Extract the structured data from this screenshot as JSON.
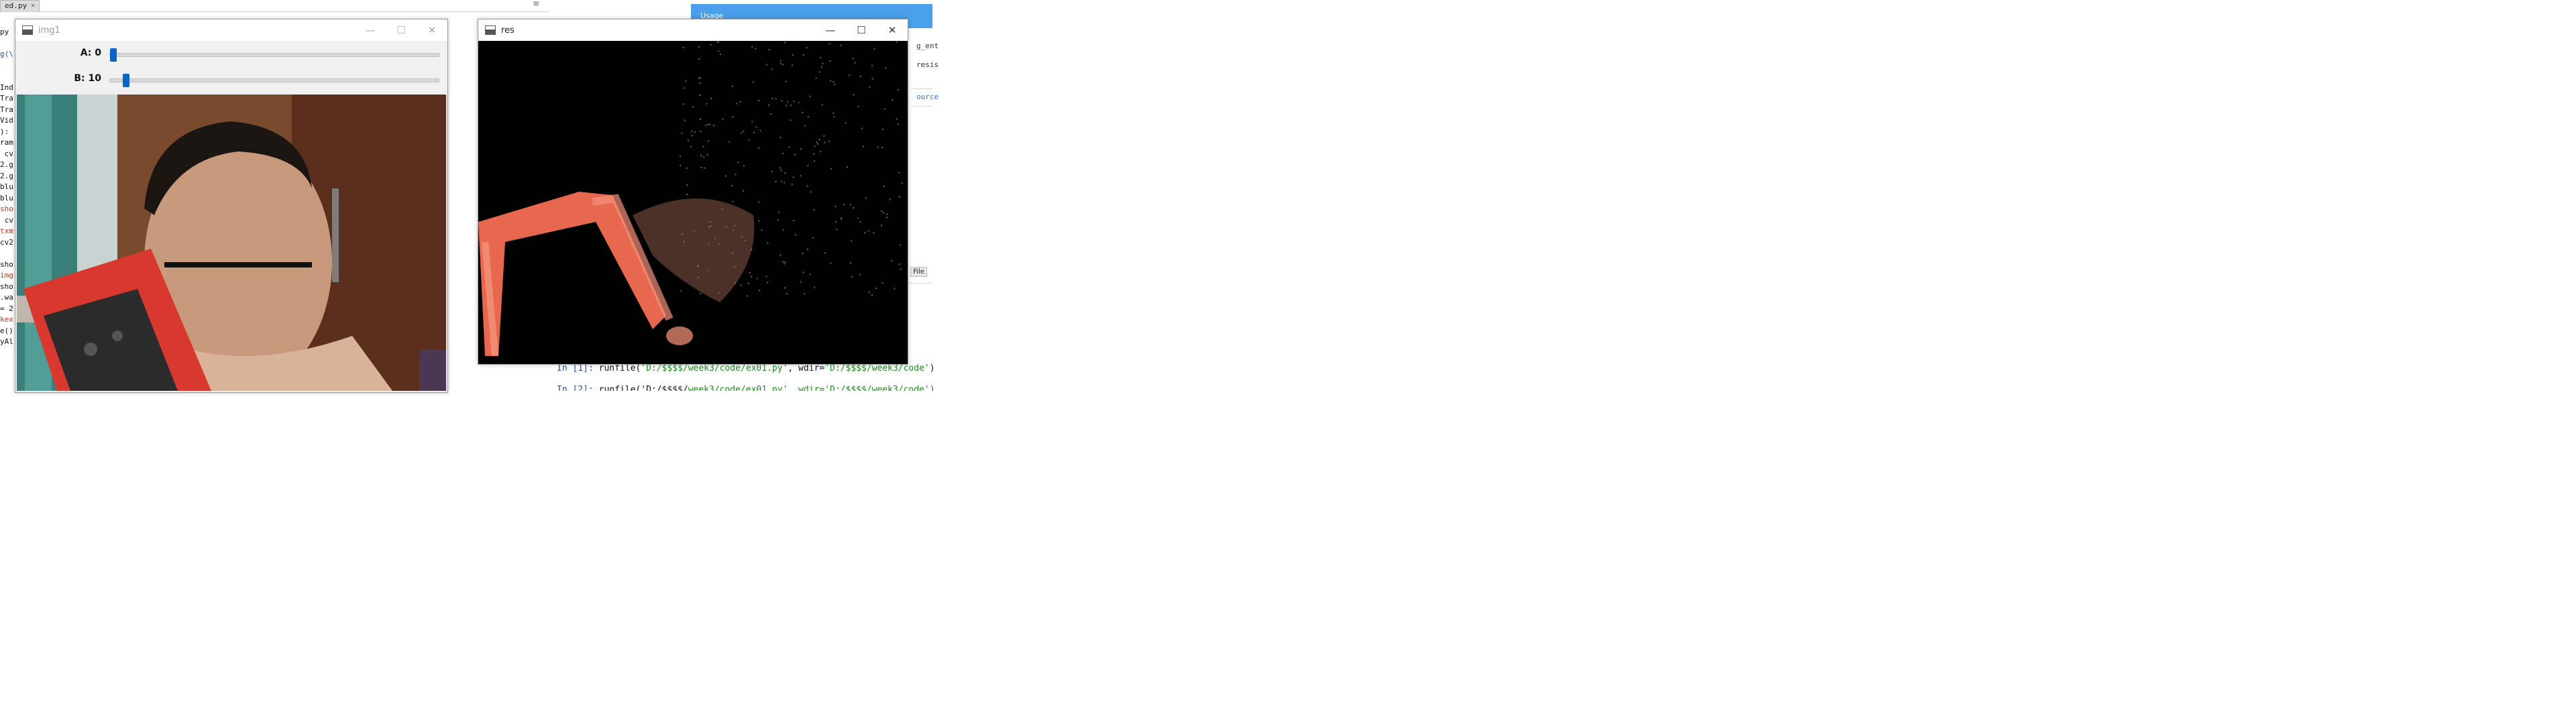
{
  "ide_left": {
    "file_tab": "ed.py",
    "tab_close": "×",
    "menu_icon": "≡",
    "code_fragments": [
      {
        "text": "py",
        "color": "default"
      },
      {
        "text": "",
        "color": "default"
      },
      {
        "text": "g(\\",
        "color": "blue"
      },
      {
        "text": "",
        "color": "default"
      },
      {
        "text": "",
        "color": "default"
      },
      {
        "text": "Ind",
        "color": "default"
      },
      {
        "text": "Tra",
        "color": "default"
      },
      {
        "text": "Tra",
        "color": "default"
      },
      {
        "text": "Vid",
        "color": "default"
      },
      {
        "text": "):",
        "color": "default"
      },
      {
        "text": "ram",
        "color": "default"
      },
      {
        "text": " cv",
        "color": "default"
      },
      {
        "text": "2.g",
        "color": "default"
      },
      {
        "text": "2.g",
        "color": "default"
      },
      {
        "text": "blu",
        "color": "default"
      },
      {
        "text": "blu",
        "color": "default"
      },
      {
        "text": "sho",
        "color": "red"
      },
      {
        "text": " cv",
        "color": "default"
      },
      {
        "text": "txm",
        "color": "red"
      },
      {
        "text": "cv2",
        "color": "default"
      },
      {
        "text": "",
        "color": "default"
      },
      {
        "text": "sho",
        "color": "default"
      },
      {
        "text": "img",
        "color": "red"
      },
      {
        "text": "sho",
        "color": "default"
      },
      {
        "text": ".wa",
        "color": "default"
      },
      {
        "text": "= 2",
        "color": "default"
      },
      {
        "text": "kex",
        "color": "red"
      },
      {
        "text": "e()",
        "color": "default"
      },
      {
        "text": "yAl",
        "color": "default"
      }
    ]
  },
  "window_img1": {
    "title": "img1",
    "minimize": "—",
    "maximize": "☐",
    "close": "✕",
    "trackbars": [
      {
        "label": "A: 0",
        "value": 0,
        "max": 255
      },
      {
        "label": "B: 10",
        "value": 10,
        "max": 255
      }
    ]
  },
  "window_res": {
    "title": "res",
    "minimize": "—",
    "maximize": "☐",
    "close": "✕"
  },
  "ide_right": {
    "banner_text": "Usage",
    "side_texts": [
      "g_ent",
      "resis",
      "ource"
    ],
    "pane_buttons": [
      "s",
      "File"
    ],
    "console": {
      "prompt": "In [1]:",
      "code_prefix": "runfile(",
      "arg1": "'D:/$$$$/week3/code/ex01.py'",
      "mid": ", wdir=",
      "arg2": "'D:/$$$$/week3/code'",
      "suffix": ")",
      "prompt2": "In [2]:",
      "line2_prefix": "runfile('D:/$$$$/",
      "line2_rest": "week3/code/ex01.py', wdir='D:/$$$$/week3/code')"
    }
  },
  "colors": {
    "trackbar_thumb": "#0a64c8",
    "ide_banner": "#4aa0ea",
    "res_mask_color": "#e8684f"
  },
  "icons": [
    "window-app-icon",
    "minimize-icon",
    "maximize-icon",
    "close-icon",
    "tab-close-icon"
  ]
}
